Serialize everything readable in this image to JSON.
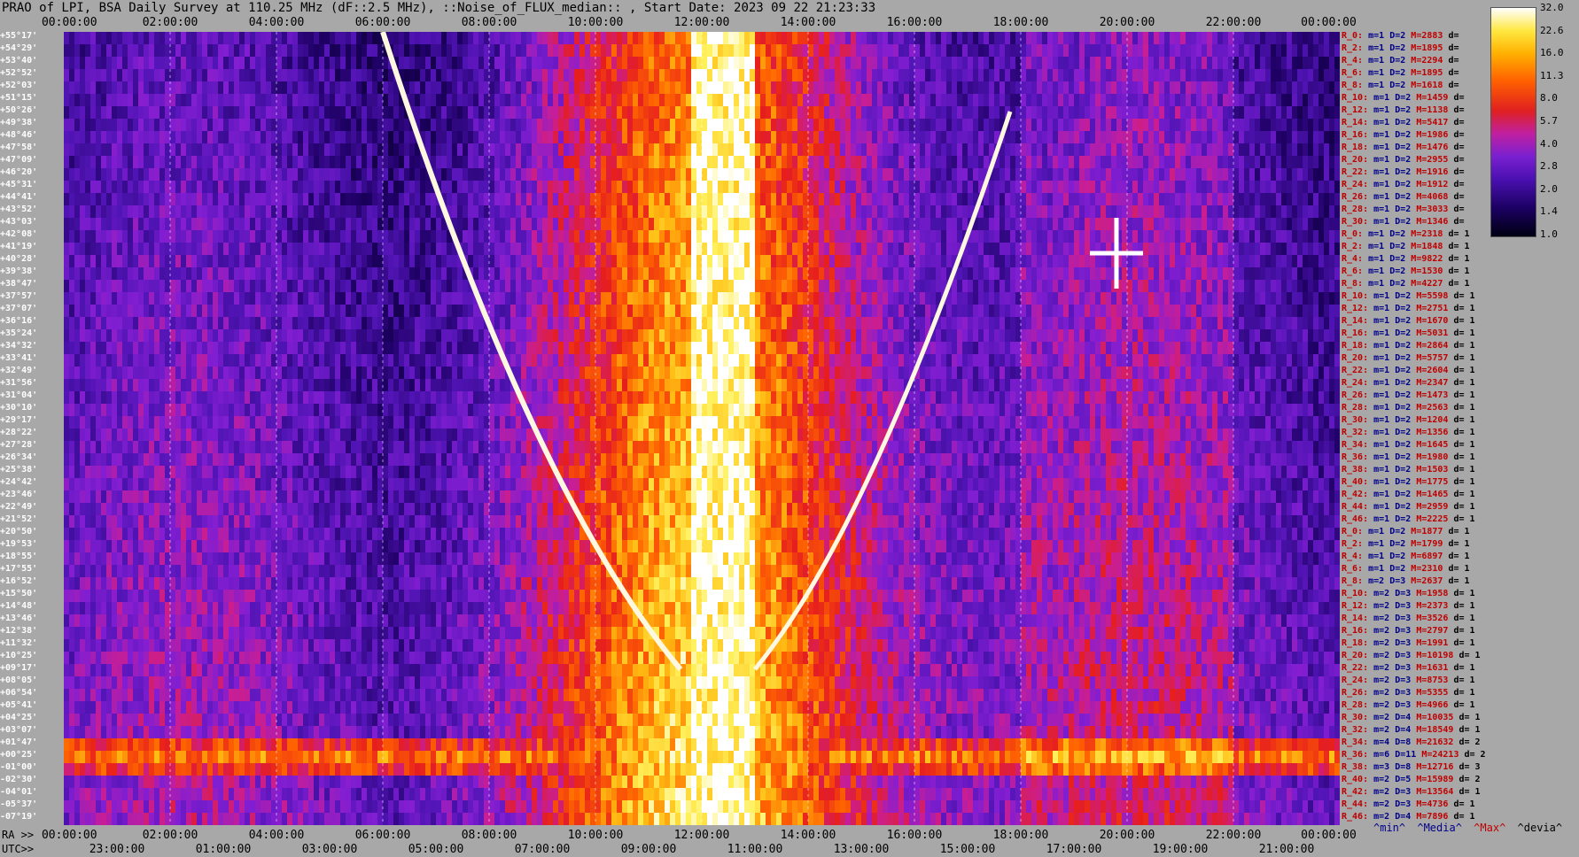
{
  "title": "PRAO of LPI, BSA Daily Survey at 110.25 MHz (dF::2.5 MHz), ::Noise_of_FLUX_median:: , Start Date: 2023 09 22 21:23:33",
  "top_ticks": [
    "00:00:00",
    "02:00:00",
    "04:00:00",
    "06:00:00",
    "08:00:00",
    "10:00:00",
    "12:00:00",
    "14:00:00",
    "16:00:00",
    "18:00:00",
    "20:00:00",
    "22:00:00",
    "00:00:00"
  ],
  "bottom_ra_label": "RA >>",
  "bottom_utc_label": "UTC>>",
  "bottom_ra_ticks": [
    "00:00:00",
    "02:00:00",
    "04:00:00",
    "06:00:00",
    "08:00:00",
    "10:00:00",
    "12:00:00",
    "14:00:00",
    "16:00:00",
    "18:00:00",
    "20:00:00",
    "22:00:00",
    "00:00:00"
  ],
  "bottom_utc_ticks": [
    "23:00:00",
    "01:00:00",
    "03:00:00",
    "05:00:00",
    "07:00:00",
    "09:00:00",
    "11:00:00",
    "13:00:00",
    "15:00:00",
    "17:00:00",
    "19:00:00",
    "21:00:00"
  ],
  "declinations": [
    "+55°17'",
    "+54°29'",
    "+53°40'",
    "+52°52'",
    "+52°03'",
    "+51°15'",
    "+50°26'",
    "+49°38'",
    "+48°46'",
    "+47°58'",
    "+47°09'",
    "+46°20'",
    "+45°31'",
    "+44°41'",
    "+43°52'",
    "+43°03'",
    "+42°08'",
    "+41°19'",
    "+40°28'",
    "+39°38'",
    "+38°47'",
    "+37°57'",
    "+37°07'",
    "+36°16'",
    "+35°24'",
    "+34°32'",
    "+33°41'",
    "+32°49'",
    "+31°56'",
    "+31°04'",
    "+30°10'",
    "+29°17'",
    "+28°22'",
    "+27°28'",
    "+26°34'",
    "+25°38'",
    "+24°42'",
    "+23°46'",
    "+22°49'",
    "+21°52'",
    "+20°50'",
    "+19°53'",
    "+18°55'",
    "+17°55'",
    "+16°52'",
    "+15°50'",
    "+14°48'",
    "+13°46'",
    "+12°38'",
    "+11°32'",
    "+10°25'",
    "+09°17'",
    "+08°05'",
    "+06°54'",
    "+05°41'",
    "+04°25'",
    "+03°07'",
    "+01°47'",
    "+00°25'",
    "-01°00'",
    "-02°30'",
    "-04°01'",
    "-05°37'",
    "-07°19'"
  ],
  "right_rows": [
    [
      "R_0:",
      "m=1",
      "D=2",
      "M=2883",
      "d="
    ],
    [
      "R_2:",
      "m=1",
      "D=2",
      "M=1895",
      "d="
    ],
    [
      "R_4:",
      "m=1",
      "D=2",
      "M=2294",
      "d="
    ],
    [
      "R_6:",
      "m=1",
      "D=2",
      "M=1895",
      "d="
    ],
    [
      "R_8:",
      "m=1",
      "D=2",
      "M=1618",
      "d="
    ],
    [
      "R_10:",
      "m=1",
      "D=2",
      "M=1459",
      "d="
    ],
    [
      "R_12:",
      "m=1",
      "D=2",
      "M=1138",
      "d="
    ],
    [
      "R_14:",
      "m=1",
      "D=2",
      "M=5417",
      "d="
    ],
    [
      "R_16:",
      "m=1",
      "D=2",
      "M=1986",
      "d="
    ],
    [
      "R_18:",
      "m=1",
      "D=2",
      "M=1476",
      "d="
    ],
    [
      "R_20:",
      "m=1",
      "D=2",
      "M=2955",
      "d="
    ],
    [
      "R_22:",
      "m=1",
      "D=2",
      "M=1916",
      "d="
    ],
    [
      "R_24:",
      "m=1",
      "D=2",
      "M=1912",
      "d="
    ],
    [
      "R_26:",
      "m=1",
      "D=2",
      "M=4068",
      "d="
    ],
    [
      "R_28:",
      "m=1",
      "D=2",
      "M=3033",
      "d="
    ],
    [
      "R_30:",
      "m=1",
      "D=2",
      "M=1346",
      "d="
    ],
    [
      "R_0:",
      "m=1",
      "D=2",
      "M=2318",
      "d= 1"
    ],
    [
      "R_2:",
      "m=1",
      "D=2",
      "M=1848",
      "d= 1"
    ],
    [
      "R_4:",
      "m=1",
      "D=2",
      "M=9822",
      "d= 1"
    ],
    [
      "R_6:",
      "m=1",
      "D=2",
      "M=1530",
      "d= 1"
    ],
    [
      "R_8:",
      "m=1",
      "D=2",
      "M=4227",
      "d= 1"
    ],
    [
      "R_10:",
      "m=1",
      "D=2",
      "M=5598",
      "d= 1"
    ],
    [
      "R_12:",
      "m=1",
      "D=2",
      "M=2751",
      "d= 1"
    ],
    [
      "R_14:",
      "m=1",
      "D=2",
      "M=1670",
      "d= 1"
    ],
    [
      "R_16:",
      "m=1",
      "D=2",
      "M=5031",
      "d= 1"
    ],
    [
      "R_18:",
      "m=1",
      "D=2",
      "M=2864",
      "d= 1"
    ],
    [
      "R_20:",
      "m=1",
      "D=2",
      "M=5757",
      "d= 1"
    ],
    [
      "R_22:",
      "m=1",
      "D=2",
      "M=2604",
      "d= 1"
    ],
    [
      "R_24:",
      "m=1",
      "D=2",
      "M=2347",
      "d= 1"
    ],
    [
      "R_26:",
      "m=1",
      "D=2",
      "M=1473",
      "d= 1"
    ],
    [
      "R_28:",
      "m=1",
      "D=2",
      "M=2563",
      "d= 1"
    ],
    [
      "R_30:",
      "m=1",
      "D=2",
      "M=1204",
      "d= 1"
    ],
    [
      "R_32:",
      "m=1",
      "D=2",
      "M=1356",
      "d= 1"
    ],
    [
      "R_34:",
      "m=1",
      "D=2",
      "M=1645",
      "d= 1"
    ],
    [
      "R_36:",
      "m=1",
      "D=2",
      "M=1980",
      "d= 1"
    ],
    [
      "R_38:",
      "m=1",
      "D=2",
      "M=1503",
      "d= 1"
    ],
    [
      "R_40:",
      "m=1",
      "D=2",
      "M=1775",
      "d= 1"
    ],
    [
      "R_42:",
      "m=1",
      "D=2",
      "M=1465",
      "d= 1"
    ],
    [
      "R_44:",
      "m=1",
      "D=2",
      "M=2959",
      "d= 1"
    ],
    [
      "R_46:",
      "m=1",
      "D=2",
      "M=2225",
      "d= 1"
    ],
    [
      "R_0:",
      "m=1",
      "D=2",
      "M=1877",
      "d= 1"
    ],
    [
      "R_2:",
      "m=1",
      "D=2",
      "M=1799",
      "d= 1"
    ],
    [
      "R_4:",
      "m=1",
      "D=2",
      "M=6897",
      "d= 1"
    ],
    [
      "R_6:",
      "m=1",
      "D=2",
      "M=2310",
      "d= 1"
    ],
    [
      "R_8:",
      "m=2",
      "D=3",
      "M=2637",
      "d= 1"
    ],
    [
      "R_10:",
      "m=2",
      "D=3",
      "M=1958",
      "d= 1"
    ],
    [
      "R_12:",
      "m=2",
      "D=3",
      "M=2373",
      "d= 1"
    ],
    [
      "R_14:",
      "m=2",
      "D=3",
      "M=3526",
      "d= 1"
    ],
    [
      "R_16:",
      "m=2",
      "D=3",
      "M=2797",
      "d= 1"
    ],
    [
      "R_18:",
      "m=2",
      "D=3",
      "M=1991",
      "d= 1"
    ],
    [
      "R_20:",
      "m=2",
      "D=3",
      "M=10198",
      "d= 1"
    ],
    [
      "R_22:",
      "m=2",
      "D=3",
      "M=1631",
      "d= 1"
    ],
    [
      "R_24:",
      "m=2",
      "D=3",
      "M=8753",
      "d= 1"
    ],
    [
      "R_26:",
      "m=2",
      "D=3",
      "M=5355",
      "d= 1"
    ],
    [
      "R_28:",
      "m=2",
      "D=3",
      "M=4966",
      "d= 1"
    ],
    [
      "R_30:",
      "m=2",
      "D=4",
      "M=10035",
      "d= 1"
    ],
    [
      "R_32:",
      "m=2",
      "D=4",
      "M=18549",
      "d= 1"
    ],
    [
      "R_34:",
      "m=4",
      "D=8",
      "M=21632",
      "d= 2"
    ],
    [
      "R_36:",
      "m=6",
      "D=11",
      "M=24213",
      "d= 2"
    ],
    [
      "R_38:",
      "m=3",
      "D=8",
      "M=12716",
      "d= 3"
    ],
    [
      "R_40:",
      "m=2",
      "D=5",
      "M=15989",
      "d= 2"
    ],
    [
      "R_42:",
      "m=2",
      "D=3",
      "M=13564",
      "d= 1"
    ],
    [
      "R_44:",
      "m=2",
      "D=3",
      "M=4736",
      "d= 1"
    ],
    [
      "R_46:",
      "m=2",
      "D=4",
      "M=7896",
      "d= 1"
    ]
  ],
  "legend_ticks": [
    "32.0",
    "22.6",
    "16.0",
    "11.3",
    "8.0",
    "5.7",
    "4.0",
    "2.8",
    "2.0",
    "1.4",
    "1.0"
  ],
  "foot_legend": {
    "min": "^min^",
    "media": "^Media^",
    "max": "^Max^",
    "devia": "^devia^"
  },
  "colors": {
    "background": "#a8a8a8",
    "low": "#000010",
    "mid": "#7a20d0",
    "high": "#ff6000",
    "peak": "#ffffff"
  },
  "chart_data": {
    "type": "heatmap",
    "title": "PRAO of LPI, BSA Daily Survey at 110.25 MHz (dF::2.5 MHz), ::Noise_of_FLUX_median:: , Start Date: 2023 09 22 21:23:33",
    "xlabel": "RA",
    "x_range": [
      "00:00:00",
      "24:00:00"
    ],
    "y_range": [
      "+55°17'",
      "-07°19'"
    ],
    "colorbar_range": [
      1.0,
      32.0
    ],
    "colorbar_scale": "log",
    "features": [
      {
        "name": "ridge",
        "ra_center_hours": 12.4
      },
      {
        "name": "band",
        "dec": "+00°25'"
      },
      {
        "name": "arc-left",
        "ra_start_hours": 6.0,
        "ra_end_hours": 11.5
      },
      {
        "name": "arc-right",
        "ra_start_hours": 13.0,
        "ra_end_hours": 17.8
      },
      {
        "name": "source",
        "ra_hours": 19.8,
        "dec": "+40°28'"
      }
    ]
  }
}
